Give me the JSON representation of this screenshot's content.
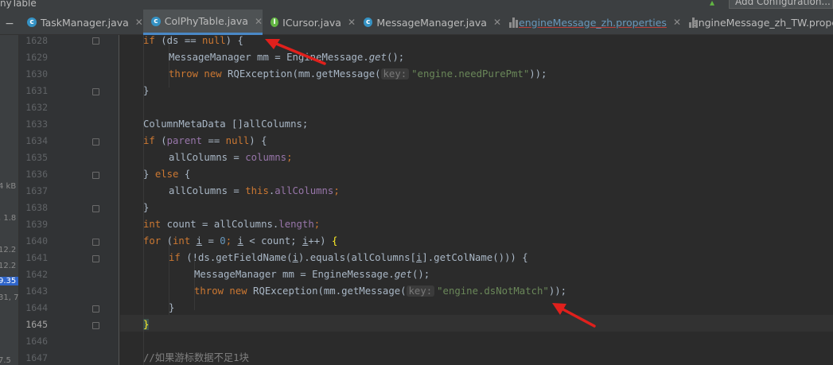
{
  "topbar": {
    "file_crumb": "nyTable",
    "run_config_label": "Add Configuration..."
  },
  "tabs": [
    {
      "label": "TaskManager.java",
      "icon": "class-icon",
      "active": false
    },
    {
      "label": "ColPhyTable.java",
      "icon": "class-icon",
      "active": true
    },
    {
      "label": "ICursor.java",
      "icon": "interface-icon",
      "active": false
    },
    {
      "label": "MessageManager.java",
      "icon": "class-icon",
      "active": false
    },
    {
      "label": "engineMessage_zh.properties",
      "icon": "properties-icon",
      "active": false
    },
    {
      "label": "engineMessage_zh_TW.prope",
      "icon": "properties-icon",
      "active": false
    }
  ],
  "tab_close_glyph": "✕",
  "left_panel_fragments": [
    "4 kB",
    ", 1.8",
    "12.2",
    "12.2",
    "9.35",
    "31, 7",
    "7.5"
  ],
  "gutter": {
    "line_numbers": [
      "1628",
      "1629",
      "1630",
      "1631",
      "1632",
      "1633",
      "1634",
      "1635",
      "1636",
      "1637",
      "1638",
      "1639",
      "1640",
      "1641",
      "1642",
      "1643",
      "1644",
      "1645",
      "1646",
      "1647"
    ],
    "current_line": "1645"
  },
  "code": {
    "l1628": {
      "a": "if",
      "b": " (ds == ",
      "c": "null",
      "d": ") {"
    },
    "l1629": {
      "a": "MessageManager mm = EngineMessage.",
      "b": "get",
      "c": "();"
    },
    "l1630": {
      "a": "throw new",
      "b": " RQException(mm.getMessage(",
      "hint": "key:",
      "s": "\"engine.needPurePmt\"",
      "e": "));"
    },
    "l1631": {
      "a": "}"
    },
    "l1633": {
      "a": "ColumnMetaData []allColumns;"
    },
    "l1634": {
      "a": "if",
      "b": " (",
      "c": "parent",
      "d": " == ",
      "e": "null",
      "f": ") {"
    },
    "l1635": {
      "a": "allColumns = ",
      "b": "columns",
      "c": ";"
    },
    "l1636": {
      "a": "} ",
      "b": "else",
      "c": " {"
    },
    "l1637": {
      "a": "allColumns = ",
      "b": "this",
      "c": ".",
      "d": "allColumns",
      "e": ";"
    },
    "l1638": {
      "a": "}"
    },
    "l1639": {
      "a": "int",
      "b": " count = allColumns.",
      "c": "length",
      "d": ";"
    },
    "l1640": {
      "a": "for",
      "b": " (",
      "c": "int",
      "d": " ",
      "e": "i",
      "f": " = ",
      "g": "0",
      "h": "; ",
      "i": "i",
      "j": " < count; ",
      "k": "i",
      "l": "++) ",
      "m": "{"
    },
    "l1641": {
      "a": "if",
      "b": " (!ds.getFieldName(",
      "c": "i",
      "d": ").equals(allColumns[",
      "e": "i",
      "f": "].getColName())) {"
    },
    "l1642": {
      "a": "MessageManager mm = EngineMessage.",
      "b": "get",
      "c": "();"
    },
    "l1643": {
      "a": "throw new",
      "b": " RQException(mm.getMessage(",
      "hint": "key:",
      "s": "\"engine.dsNotMatch\"",
      "e": "));"
    },
    "l1644": {
      "a": "}"
    },
    "l1645": {
      "a": "}"
    },
    "l1647": {
      "a": "//如果游标数据不足1块"
    }
  },
  "colors": {
    "annotation_arrow": "#e0201c",
    "keyword": "#cc7832",
    "string": "#6a8759",
    "field": "#9876aa"
  }
}
